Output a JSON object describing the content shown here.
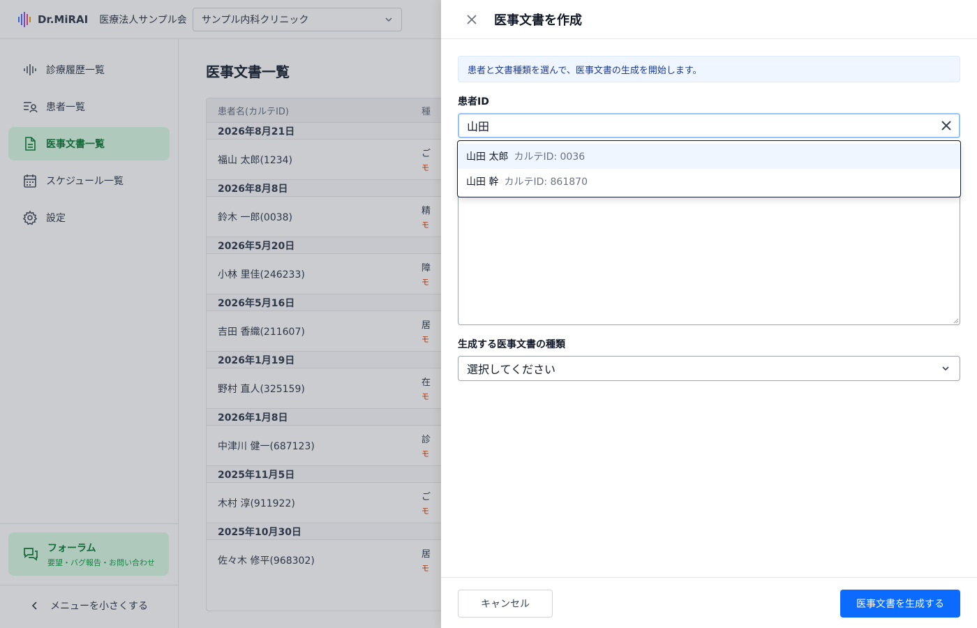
{
  "app": {
    "logo_text": "Dr.MiRAI",
    "org_name": "医療法人サンプル会",
    "clinic_select": "サンプル内科クリニック"
  },
  "sidebar": {
    "items": [
      {
        "label": "診療履歴一覧",
        "icon": "waveform-icon",
        "active": false
      },
      {
        "label": "患者一覧",
        "icon": "patient-list-icon",
        "active": false
      },
      {
        "label": "医事文書一覧",
        "icon": "document-icon",
        "active": true
      },
      {
        "label": "スケジュール一覧",
        "icon": "calendar-icon",
        "active": false
      },
      {
        "label": "設定",
        "icon": "gear-icon",
        "active": false
      }
    ],
    "forum": {
      "title": "フォーラム",
      "subtitle": "要望・バグ報告・お問い合わせ"
    },
    "collapse_label": "メニューを小さくする"
  },
  "main": {
    "title": "医事文書一覧",
    "columns": [
      "患者名(カルテID)",
      "種"
    ],
    "groups": [
      {
        "date": "2026年8月21日",
        "patient": "福山 太郎(1234)",
        "type1": "ご",
        "type2": "モ"
      },
      {
        "date": "2026年8月8日",
        "patient": "鈴木 一郎(0038)",
        "type1": "精",
        "type2": "モ"
      },
      {
        "date": "2026年5月20日",
        "patient": "小林 里佳(246233)",
        "type1": "障",
        "type2": "モ"
      },
      {
        "date": "2026年5月16日",
        "patient": "吉田 香織(211607)",
        "type1": "居",
        "type2": "モ"
      },
      {
        "date": "2026年1月19日",
        "patient": "野村 直人(325159)",
        "type1": "在",
        "type2": "モ"
      },
      {
        "date": "2026年1月8日",
        "patient": "中津川 健一(687123)",
        "type1": "診",
        "type2": "モ"
      },
      {
        "date": "2025年11月5日",
        "patient": "木村 淳(911922)",
        "type1": "ご",
        "type2": "モ"
      },
      {
        "date": "2025年10月30日",
        "patient": "佐々木 修平(968302)",
        "type1": "居",
        "type2": "モ"
      }
    ]
  },
  "drawer": {
    "title": "医事文書を作成",
    "info": "患者と文書種類を選んで、医事文書の生成を開始します。",
    "patient_label": "患者ID",
    "patient_value": "山田",
    "suggestions": [
      {
        "name": "山田 太郎",
        "id": "カルテID: 0036"
      },
      {
        "name": "山田 幹",
        "id": "カルテID: 861870"
      }
    ],
    "type_label": "生成する医事文書の種類",
    "type_placeholder": "選択してください",
    "cancel": "キャンセル",
    "generate": "医事文書を生成する"
  },
  "colors": {
    "accent": "#0b6bff",
    "active_bg": "#dcfce7",
    "active_text": "#15803d"
  }
}
